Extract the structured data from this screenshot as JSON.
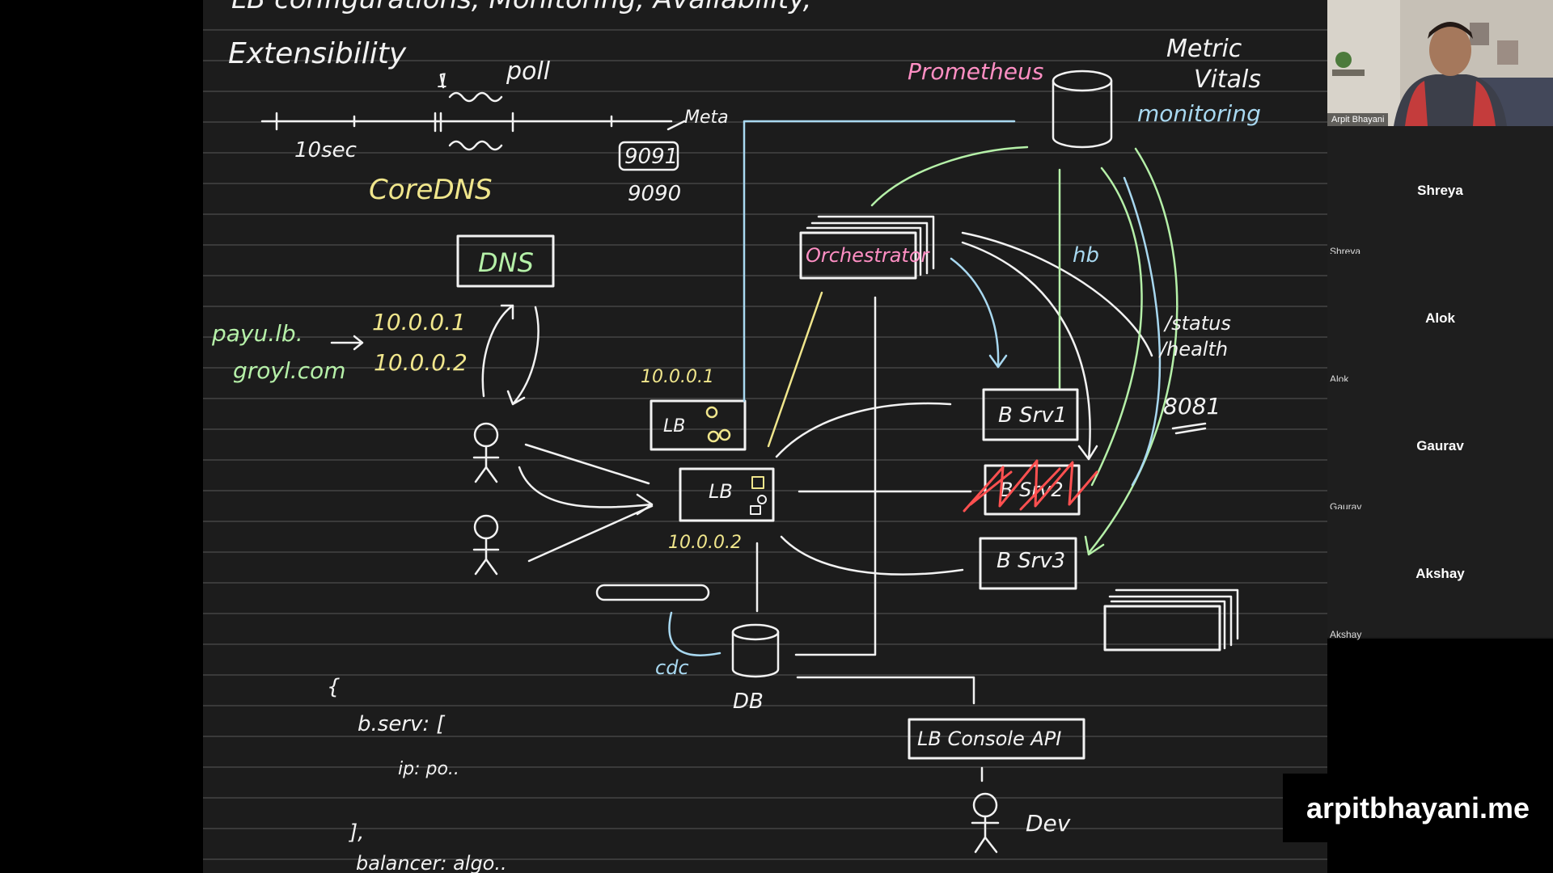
{
  "whiteboard": {
    "title_partial": "LB configurations, Monitoring, Availability,",
    "extensibility": "Extensibility",
    "timeline": {
      "poll": "poll",
      "tick_one": "1",
      "ten_sec": "10sec",
      "meta": "Meta",
      "port_box": "9091",
      "port_below": "9090",
      "coredns": "CoreDNS"
    },
    "dns_box": "DNS",
    "hostnames": [
      "payu.lb.",
      "groyl.com"
    ],
    "ips": [
      "10.0.0.1",
      "10.0.0.2"
    ],
    "lb1_ip": "10.0.0.1",
    "lb1_label": "LB",
    "lb2_label": "LB",
    "lb2_ip": "10.0.0.2",
    "prometheus": "Prometheus",
    "metric_vitals": [
      "Metric",
      "Vitals"
    ],
    "monitoring": "monitoring",
    "orchestrator": "Orchestrator",
    "hb": "hb",
    "status_health": [
      "/status",
      "/health"
    ],
    "port_8081": "8081",
    "bsrv1": "B Srv1",
    "bsrv2": "B Srv2",
    "bsrv3": "B Srv3",
    "cdc": "cdc",
    "db": "DB",
    "console_api": "LB Console API",
    "dev": "Dev",
    "code_lines": [
      "{",
      "b.serv: [",
      "ip: po..",
      "],",
      "balancer: algo.."
    ]
  },
  "meeting": {
    "presenter_name": "Arpit Bhayani",
    "participants": [
      {
        "name": "Shreya"
      },
      {
        "name": "Alok"
      },
      {
        "name": "Gaurav"
      },
      {
        "name": "Akshay"
      }
    ],
    "brand": "arpitbhayani.me"
  },
  "colors": {
    "board_bg": "#1c1c1c",
    "chalk_white": "#f2f2f2",
    "yellow": "#f0e68c",
    "green": "#b5f0a8",
    "pink": "#ff8fc4",
    "blue": "#a8d8f0",
    "red": "#ff5050"
  }
}
